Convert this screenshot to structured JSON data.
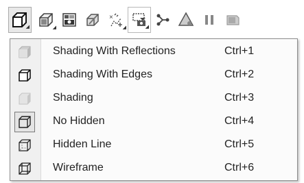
{
  "toolbar": {
    "buttons": [
      {
        "name": "display-style-icon",
        "active": true
      },
      {
        "name": "view-orientation-icon"
      },
      {
        "name": "render-tools-icon"
      },
      {
        "name": "section-view-icon"
      },
      {
        "name": "hide-show-items-icon"
      },
      {
        "name": "view-settings-icon"
      },
      {
        "name": "sketch-relations-icon"
      },
      {
        "name": "appearance-icon"
      },
      {
        "name": "pause-icon"
      },
      {
        "name": "scene-icon"
      }
    ]
  },
  "menu": {
    "items": [
      {
        "label": "Shading With Reflections",
        "shortcut": "Ctrl+1",
        "icon": "shaded-reflections-icon"
      },
      {
        "label": "Shading With Edges",
        "shortcut": "Ctrl+2",
        "icon": "shaded-edges-icon"
      },
      {
        "label": "Shading",
        "shortcut": "Ctrl+3",
        "icon": "shaded-icon"
      },
      {
        "label": "No Hidden",
        "shortcut": "Ctrl+4",
        "icon": "hidden-removed-icon",
        "checked": true
      },
      {
        "label": "Hidden Line",
        "shortcut": "Ctrl+5",
        "icon": "hidden-lines-visible-icon"
      },
      {
        "label": "Wireframe",
        "shortcut": "Ctrl+6",
        "icon": "wireframe-icon"
      }
    ]
  }
}
